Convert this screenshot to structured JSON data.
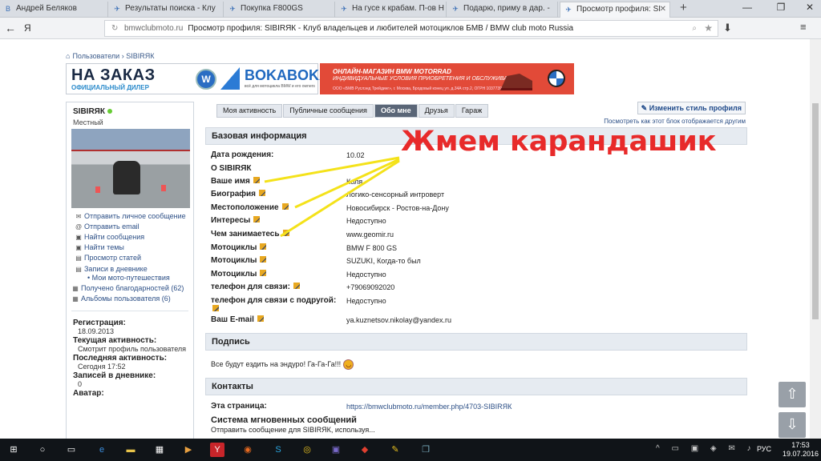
{
  "browser": {
    "tabs": [
      {
        "label": "Андрей Беляков",
        "icon": "vk-icon",
        "active": false
      },
      {
        "label": "Результаты поиска - Клу",
        "icon": "bmw-favicon",
        "active": false
      },
      {
        "label": "Покупка F800GS",
        "icon": "bmw-favicon",
        "active": false
      },
      {
        "label": "На гусе к крабам. П-ов Н",
        "icon": "bmw-favicon",
        "active": false
      },
      {
        "label": "Подарю, приму в дар. -",
        "icon": "bmw-favicon",
        "active": false
      },
      {
        "label": "Просмотр профиля: SI",
        "icon": "bmw-favicon",
        "active": true
      }
    ],
    "address": {
      "domain": "bmwclubmoto.ru",
      "title": "Просмотр профиля: SIBIRЯК - Клуб владельцев и любителей мотоциклов БМВ / BMW club moto Russia"
    }
  },
  "page": {
    "breadcrumb": {
      "root": "Пользователи",
      "current": "SIBIRЯК"
    },
    "banner_left": {
      "big": "НА ЗАКАЗ",
      "small": "ОФИЦИАЛЬНЫЙ ДИЛЕР",
      "brand": "BOKABOKA",
      "brand_sub": "всё для мотоцикла BMW и его owners"
    },
    "banner_right": {
      "line1": "ОНЛАЙН-МАГАЗИН BMW MOTORRAD",
      "line2": "ИНДИВИДУАЛЬНЫЕ УСЛОВИЯ ПРИОБРЕТЕНИЯ И ОБСЛУЖИВАНИЯ",
      "line3": "ООО «БМВ Руслэнд Трейдинг», г. Москва, Бродовый конец ул. д.34А стр.2, ОГРН 1037739194844"
    },
    "sidebar": {
      "username": "SIBIRЯК",
      "user_title": "Местный",
      "links": [
        {
          "label": "Отправить личное сообщение",
          "icon": "message-icon"
        },
        {
          "label": "Отправить email",
          "icon": "email-icon"
        },
        {
          "label": "Найти сообщения",
          "icon": "search-posts-icon"
        },
        {
          "label": "Найти темы",
          "icon": "search-threads-icon"
        },
        {
          "label": "Просмотр статей",
          "icon": "articles-icon"
        },
        {
          "label": "Записи в дневнике",
          "icon": "blog-icon"
        },
        {
          "label": "Мои мото-путешествия",
          "icon": ""
        },
        {
          "label": "Получено благодарностей (62)",
          "icon": "thanks-icon"
        },
        {
          "label": "Альбомы пользователя (6)",
          "icon": "album-icon"
        }
      ],
      "stats": {
        "reg_label": "Регистрация:",
        "reg_value": "18.09.2013",
        "current_label": "Текущая активность:",
        "current_value": "Смотрит профиль пользователя",
        "last_label": "Последняя активность:",
        "last_value": "Сегодня 17:52",
        "diary_label": "Записей в дневнике:",
        "diary_value": "0",
        "avatar_label": "Аватар:"
      }
    },
    "profile_tabs": [
      "Моя активность",
      "Публичные сообщения",
      "Обо мне",
      "Друзья",
      "Гараж"
    ],
    "edit_style": "Изменить стиль профиля",
    "see_as": "Посмотреть как этот блок отображается другим",
    "basic": {
      "heading": "Базовая информация",
      "dob_label": "Дата рождения:",
      "dob_value": "10.02",
      "about_heading": "О SIBIRЯК",
      "fields": [
        {
          "label": "Ваше имя",
          "value": "Коля"
        },
        {
          "label": "Биография",
          "value": "Логико-сенсорный интроверт"
        },
        {
          "label": "Местоположение",
          "value": "Новосибирск - Ростов-на-Дону"
        },
        {
          "label": "Интересы",
          "value": "Недоступно"
        },
        {
          "label": "Чем занимаетесь",
          "value": "www.geomir.ru"
        },
        {
          "label": "Мотоциклы",
          "value": "BMW F 800 GS"
        },
        {
          "label": "Мотоциклы",
          "value": "SUZUKI, Когда-то был"
        },
        {
          "label": "Мотоциклы",
          "value": "Недоступно"
        },
        {
          "label": "телефон для связи:",
          "value": "+79069092020"
        },
        {
          "label": "телефон для связи с подругой:",
          "value": "Недоступно"
        },
        {
          "label": "Ваш E-mail",
          "value": "ya.kuznetsov.nikolay@yandex.ru"
        }
      ]
    },
    "signature": {
      "heading": "Подпись",
      "text": "Все будут ездить на эндуро! Га-Га-Га!!!"
    },
    "contacts": {
      "heading": "Контакты",
      "page_label": "Эта страница:",
      "page_value": "https://bmwclubmoto.ru/member.php/4703-SIBIRЯК",
      "im_heading": "Система мгновенных сообщений",
      "im_text": "Отправить сообщение для SIBIRЯК, используя..."
    },
    "annotation": "Жмем карандашик"
  },
  "taskbar": {
    "lang": "РУС",
    "time": "17:53",
    "date": "19.07.2016"
  },
  "colors": {
    "annotation": "#e82a2a",
    "arrows": "#f4e21a",
    "accent": "#2c4f86"
  }
}
